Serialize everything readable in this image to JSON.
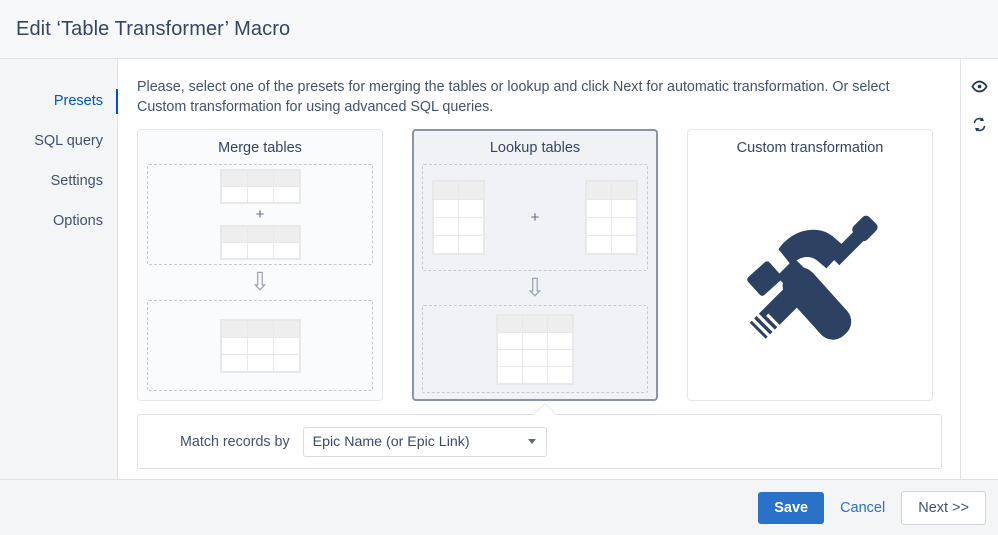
{
  "window": {
    "title": "Edit ‘Table Transformer’ Macro"
  },
  "sidebar": {
    "items": [
      {
        "label": "Presets",
        "active": true
      },
      {
        "label": "SQL query",
        "active": false
      },
      {
        "label": "Settings",
        "active": false
      },
      {
        "label": "Options",
        "active": false
      }
    ]
  },
  "main": {
    "intro": "Please, select one of the presets for merging the tables or lookup and click Next for automatic transformation. Or select Custom transformation for using advanced SQL queries.",
    "presets": [
      {
        "title": "Merge tables",
        "selected": false
      },
      {
        "title": "Lookup tables",
        "selected": true
      },
      {
        "title": "Custom transformation",
        "selected": false
      }
    ],
    "plus_symbol": "+",
    "arrow_symbol": "⇩",
    "match": {
      "label": "Match records by",
      "selected_option": "Epic Name (or Epic Link)"
    }
  },
  "rail": {
    "preview_icon": "eye-icon",
    "refresh_icon": "refresh-icon"
  },
  "footer": {
    "save_label": "Save",
    "cancel_label": "Cancel",
    "next_label": "Next >>"
  },
  "colors": {
    "accent_blue": "#0052cc",
    "button_blue": "#2a72c8",
    "text_slate": "#42526e",
    "icon_navy": "#2d4263",
    "selected_border": "#8894ae"
  }
}
